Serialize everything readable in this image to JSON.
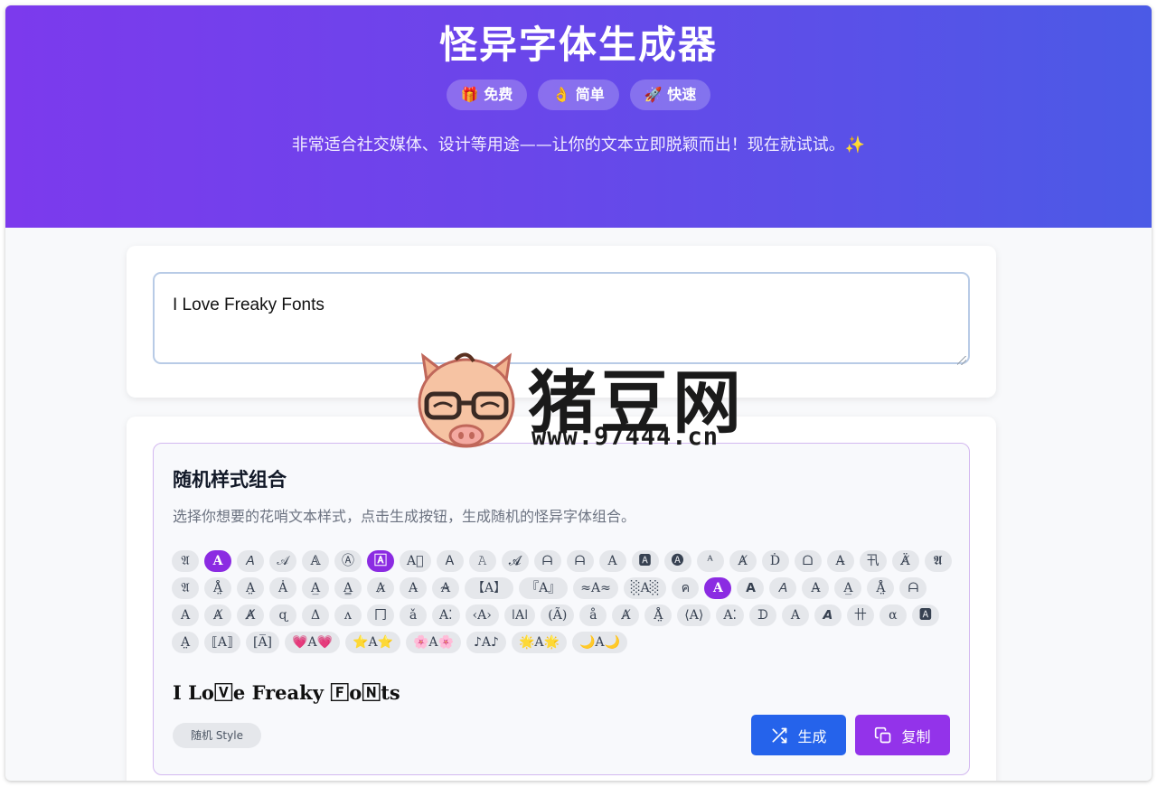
{
  "hero": {
    "title": "怪异字体生成器",
    "badges": [
      {
        "icon": "gift-icon",
        "emoji": "🎁",
        "label": "免费"
      },
      {
        "icon": "ok-hand-icon",
        "emoji": "👌",
        "label": "简单"
      },
      {
        "icon": "rocket-icon",
        "emoji": "🚀",
        "label": "快速"
      }
    ],
    "subtitle": "非常适合社交媒体、设计等用途——让你的文本立即脱颖而出！现在就试试。✨"
  },
  "input": {
    "value": "I Love Freaky Fonts"
  },
  "generator": {
    "title": "随机样式组合",
    "description": "选择你想要的花哨文本样式，点击生成按钮，生成随机的怪异字体组合。",
    "styles": [
      {
        "label": "𝔄",
        "selected": false
      },
      {
        "label": "𝐀",
        "selected": true
      },
      {
        "label": "𝘈",
        "selected": false
      },
      {
        "label": "𝒜",
        "selected": false
      },
      {
        "label": "𝔸",
        "selected": false
      },
      {
        "label": "Ⓐ",
        "selected": false
      },
      {
        "label": "🄰",
        "selected": true
      },
      {
        "label": "A⃞",
        "selected": false
      },
      {
        "label": "Ａ",
        "selected": false
      },
      {
        "label": "𝙰",
        "selected": false
      },
      {
        "label": "𝓐",
        "selected": false
      },
      {
        "label": "ᗩ",
        "selected": false
      },
      {
        "label": "ᗩ",
        "selected": false
      },
      {
        "label": "A",
        "selected": false
      },
      {
        "label": "🅰",
        "selected": false
      },
      {
        "label": "🅐",
        "selected": false
      },
      {
        "label": "ᴬ",
        "selected": false
      },
      {
        "label": "Ⱥ",
        "selected": false
      },
      {
        "label": "Ḋ",
        "selected": false
      },
      {
        "label": "ᗝ",
        "selected": false
      },
      {
        "label": "A̶",
        "selected": false
      },
      {
        "label": "卂",
        "selected": false
      },
      {
        "label": "Ä̸",
        "selected": false
      },
      {
        "label": "𝕬",
        "selected": false
      },
      {
        "label": "𝔄",
        "selected": false
      },
      {
        "label": "Å̤",
        "selected": false
      },
      {
        "label": "A̤",
        "selected": false
      },
      {
        "label": "Ȧ",
        "selected": false
      },
      {
        "label": "A̲",
        "selected": false
      },
      {
        "label": "A̳",
        "selected": false
      },
      {
        "label": "A̷",
        "selected": false
      },
      {
        "label": "A̵",
        "selected": false
      },
      {
        "label": "A̴",
        "selected": false
      },
      {
        "label": "【A】",
        "selected": false
      },
      {
        "label": "『A』",
        "selected": false
      },
      {
        "label": "≈A≈",
        "selected": false
      },
      {
        "label": "░A░",
        "selected": false
      },
      {
        "label": "ค",
        "selected": false
      },
      {
        "label": "𝐀",
        "selected": true
      },
      {
        "label": "𝗔",
        "selected": false
      },
      {
        "label": "𝘈",
        "selected": false
      },
      {
        "label": "A̶",
        "selected": false
      },
      {
        "label": "A̲",
        "selected": false
      },
      {
        "label": "Å̤",
        "selected": false
      },
      {
        "label": "ᗩ",
        "selected": false
      },
      {
        "label": "A",
        "selected": false
      },
      {
        "label": "Ⱥ",
        "selected": false
      },
      {
        "label": "Ⱥ̸",
        "selected": false
      },
      {
        "label": "ɋ",
        "selected": false
      },
      {
        "label": "Δ",
        "selected": false
      },
      {
        "label": "ᴧ",
        "selected": false
      },
      {
        "label": "冂",
        "selected": false
      },
      {
        "label": "ǎ",
        "selected": false
      },
      {
        "label": "A⁚",
        "selected": false
      },
      {
        "label": "‹A›",
        "selected": false
      },
      {
        "label": "ǀAǀ",
        "selected": false
      },
      {
        "label": "(Ã)",
        "selected": false
      },
      {
        "label": "å",
        "selected": false
      },
      {
        "label": "Ⱥ",
        "selected": false
      },
      {
        "label": "Å̤",
        "selected": false
      },
      {
        "label": "⟨A⟩",
        "selected": false
      },
      {
        "label": "A⁚",
        "selected": false
      },
      {
        "label": "ᗪ",
        "selected": false
      },
      {
        "label": "A",
        "selected": false
      },
      {
        "label": "𝘼",
        "selected": false
      },
      {
        "label": "卄",
        "selected": false
      },
      {
        "label": "α",
        "selected": false
      },
      {
        "label": "🅰",
        "selected": false
      },
      {
        "label": "A̤",
        "selected": false
      },
      {
        "label": "⟦A⟧",
        "selected": false
      },
      {
        "label": "[A̅]",
        "selected": false
      },
      {
        "label": "💗A💗",
        "selected": false
      },
      {
        "label": "⭐A⭐",
        "selected": false
      },
      {
        "label": "🌸A🌸",
        "selected": false
      },
      {
        "label": "♪A♪",
        "selected": false
      },
      {
        "label": "🌟A🌟",
        "selected": false
      },
      {
        "label": "🌙A🌙",
        "selected": false
      }
    ],
    "preview": "I Lo🅅e Freaky 🄵o🄽ts",
    "style_tag": "随机 Style",
    "generate_label": "生成",
    "copy_label": "复制"
  },
  "watermark": {
    "text": "猪豆网",
    "url": "www.97444.cn"
  },
  "colors": {
    "hero_start": "#7c3aed",
    "hero_end": "#4b5ae6",
    "selected_chip": "#8b2be2",
    "generate_button": "#2563eb",
    "copy_button": "#9333ea"
  }
}
